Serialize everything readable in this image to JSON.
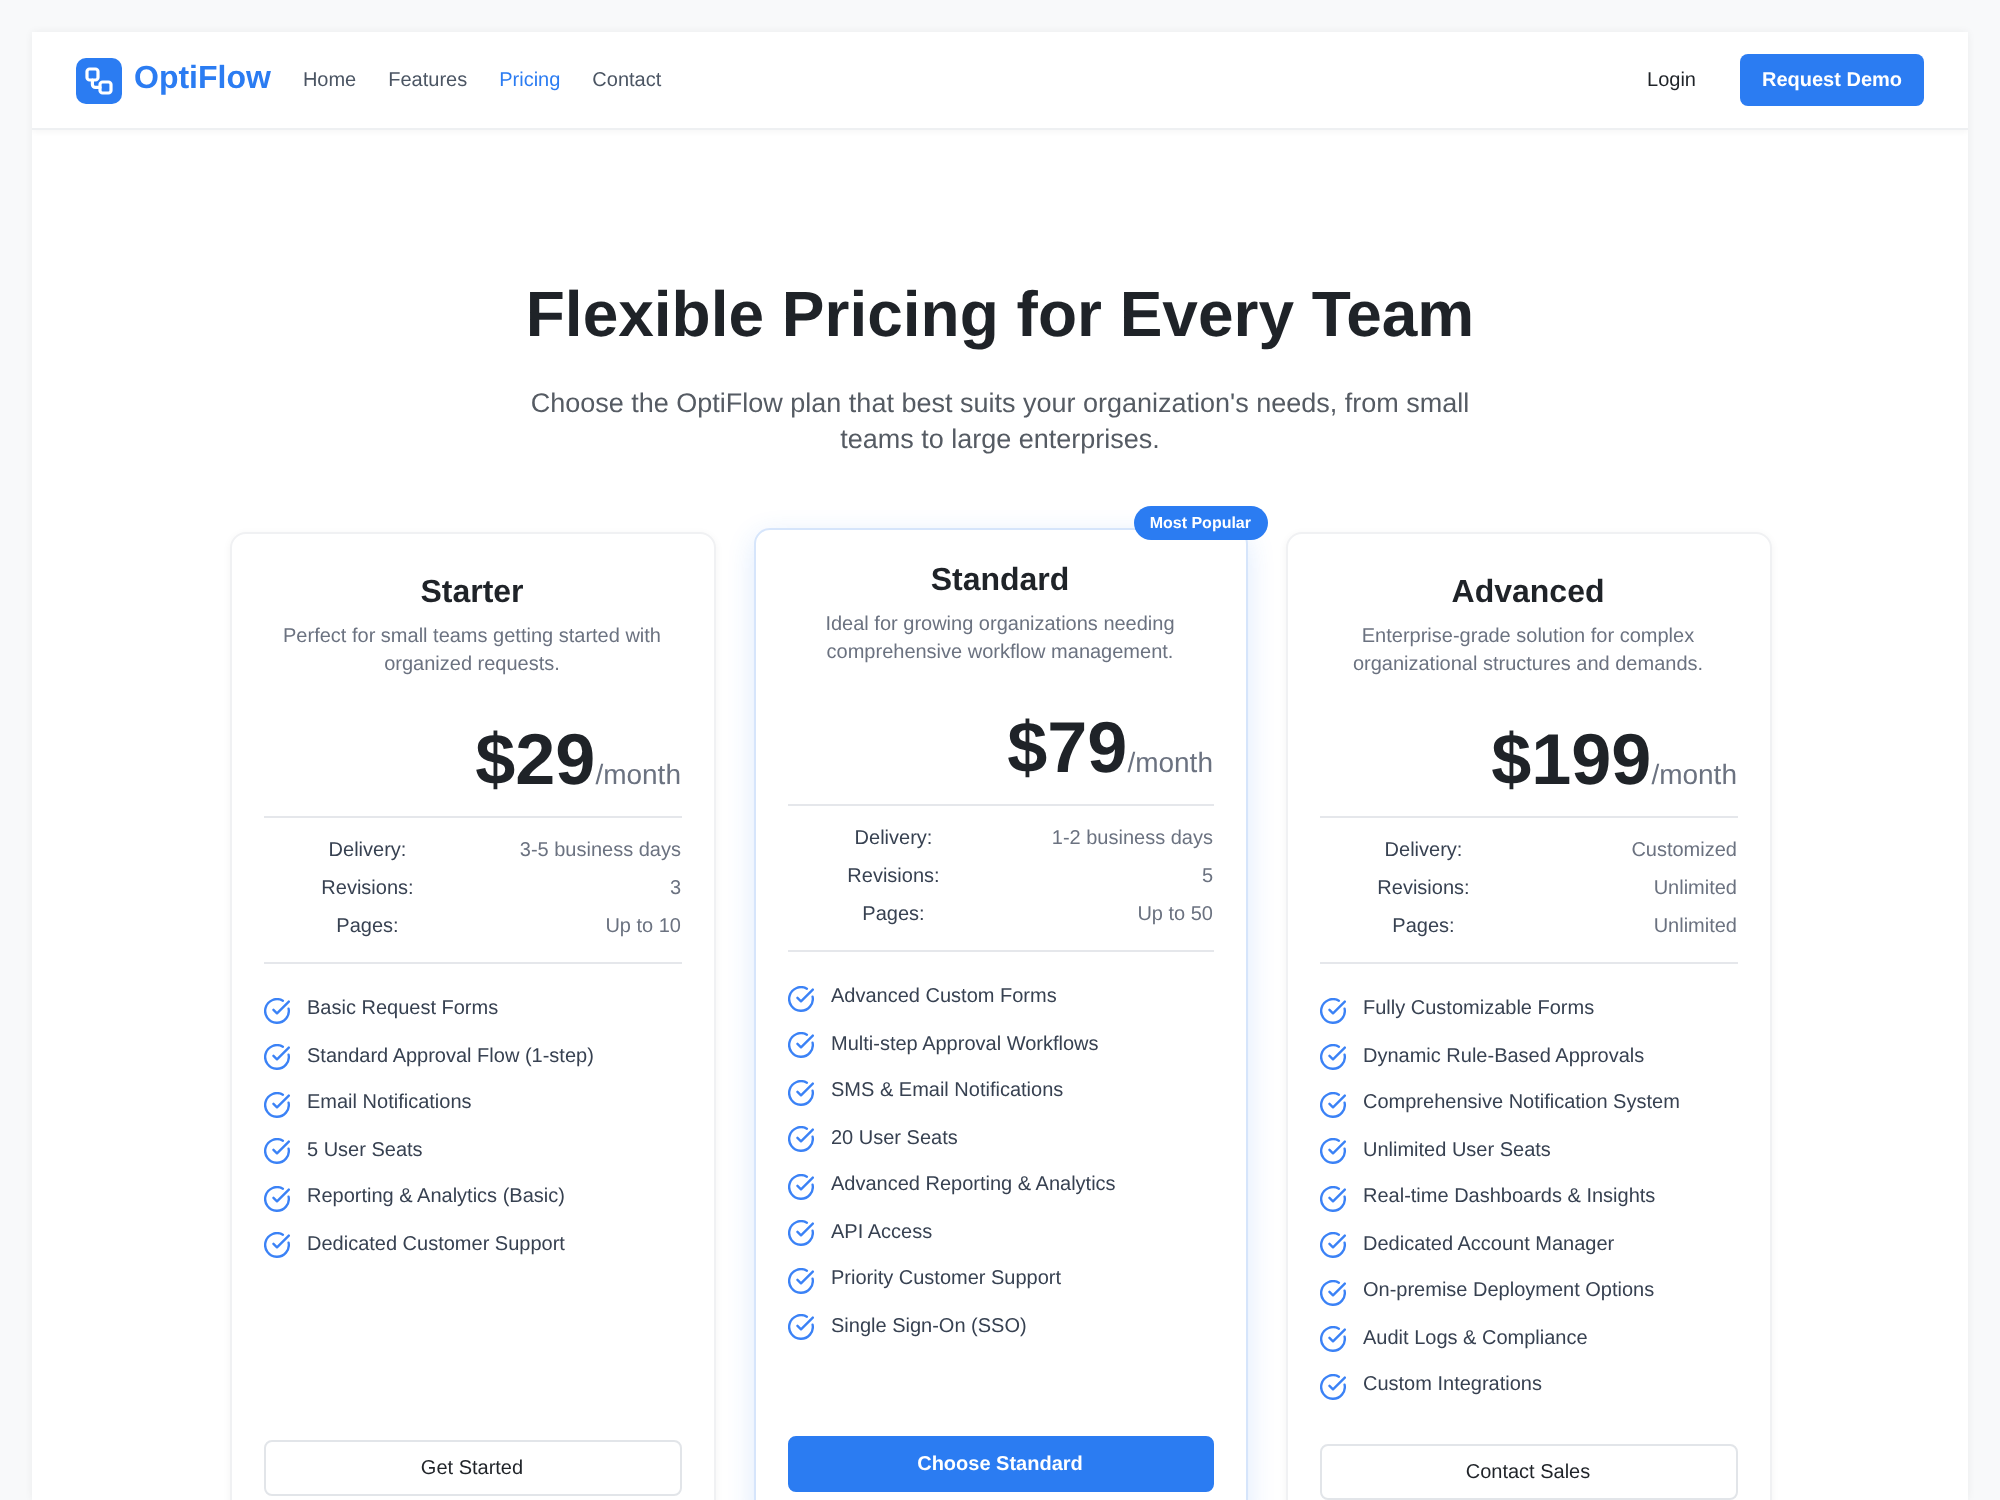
{
  "header": {
    "logo": "OptiFlow",
    "nav": [
      {
        "label": "Home",
        "selected": false
      },
      {
        "label": "Features",
        "selected": false
      },
      {
        "label": "Pricing",
        "selected": true
      },
      {
        "label": "Contact",
        "selected": false
      }
    ],
    "login": "Login",
    "cta": "Request Demo"
  },
  "hero": {
    "title": "Flexible Pricing for Every Team",
    "subtitle": "Choose the OptiFlow plan that best suits your organization's needs, from small teams to large enterprises."
  },
  "plans": [
    {
      "name": "Starter",
      "description": "Perfect for small teams getting started with organized requests.",
      "price": "$29",
      "period": "/month",
      "featured": false,
      "specs": [
        {
          "label": "Delivery:",
          "value": "3-5 business days"
        },
        {
          "label": "Revisions:",
          "value": "3"
        },
        {
          "label": "Pages:",
          "value": "Up to 10"
        }
      ],
      "features": [
        "Basic Request Forms",
        "Standard Approval Flow (1-step)",
        "Email Notifications",
        "5 User Seats",
        "Reporting & Analytics (Basic)",
        "Dedicated Customer Support"
      ],
      "button": "Get Started"
    },
    {
      "name": "Standard",
      "badge": "Most Popular",
      "description": "Ideal for growing organizations needing comprehensive workflow management.",
      "price": "$79",
      "period": "/month",
      "featured": true,
      "specs": [
        {
          "label": "Delivery:",
          "value": "1-2 business days"
        },
        {
          "label": "Revisions:",
          "value": "5"
        },
        {
          "label": "Pages:",
          "value": "Up to 50"
        }
      ],
      "features": [
        "Advanced Custom Forms",
        "Multi-step Approval Workflows",
        "SMS & Email Notifications",
        "20 User Seats",
        "Advanced Reporting & Analytics",
        "API Access",
        "Priority Customer Support",
        "Single Sign-On (SSO)"
      ],
      "button": "Choose Standard"
    },
    {
      "name": "Advanced",
      "description": "Enterprise-grade solution for complex organizational structures and demands.",
      "price": "$199",
      "period": "/month",
      "featured": false,
      "specs": [
        {
          "label": "Delivery:",
          "value": "Customized"
        },
        {
          "label": "Revisions:",
          "value": "Unlimited"
        },
        {
          "label": "Pages:",
          "value": "Unlimited"
        }
      ],
      "features": [
        "Fully Customizable Forms",
        "Dynamic Rule-Based Approvals",
        "Comprehensive Notification System",
        "Unlimited User Seats",
        "Real-time Dashboards & Insights",
        "Dedicated Account Manager",
        "On-premise Deployment Options",
        "Audit Logs & Compliance",
        "Custom Integrations"
      ],
      "button": "Contact Sales"
    }
  ]
}
